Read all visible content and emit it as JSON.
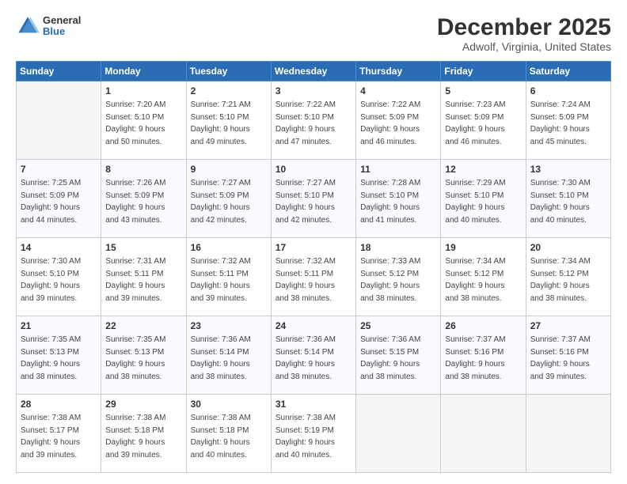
{
  "logo": {
    "general": "General",
    "blue": "Blue"
  },
  "header": {
    "title": "December 2025",
    "subtitle": "Adwolf, Virginia, United States"
  },
  "weekdays": [
    "Sunday",
    "Monday",
    "Tuesday",
    "Wednesday",
    "Thursday",
    "Friday",
    "Saturday"
  ],
  "weeks": [
    [
      {
        "day": "",
        "info": ""
      },
      {
        "day": "1",
        "info": "Sunrise: 7:20 AM\nSunset: 5:10 PM\nDaylight: 9 hours\nand 50 minutes."
      },
      {
        "day": "2",
        "info": "Sunrise: 7:21 AM\nSunset: 5:10 PM\nDaylight: 9 hours\nand 49 minutes."
      },
      {
        "day": "3",
        "info": "Sunrise: 7:22 AM\nSunset: 5:10 PM\nDaylight: 9 hours\nand 47 minutes."
      },
      {
        "day": "4",
        "info": "Sunrise: 7:22 AM\nSunset: 5:09 PM\nDaylight: 9 hours\nand 46 minutes."
      },
      {
        "day": "5",
        "info": "Sunrise: 7:23 AM\nSunset: 5:09 PM\nDaylight: 9 hours\nand 46 minutes."
      },
      {
        "day": "6",
        "info": "Sunrise: 7:24 AM\nSunset: 5:09 PM\nDaylight: 9 hours\nand 45 minutes."
      }
    ],
    [
      {
        "day": "7",
        "info": "Sunrise: 7:25 AM\nSunset: 5:09 PM\nDaylight: 9 hours\nand 44 minutes."
      },
      {
        "day": "8",
        "info": "Sunrise: 7:26 AM\nSunset: 5:09 PM\nDaylight: 9 hours\nand 43 minutes."
      },
      {
        "day": "9",
        "info": "Sunrise: 7:27 AM\nSunset: 5:09 PM\nDaylight: 9 hours\nand 42 minutes."
      },
      {
        "day": "10",
        "info": "Sunrise: 7:27 AM\nSunset: 5:10 PM\nDaylight: 9 hours\nand 42 minutes."
      },
      {
        "day": "11",
        "info": "Sunrise: 7:28 AM\nSunset: 5:10 PM\nDaylight: 9 hours\nand 41 minutes."
      },
      {
        "day": "12",
        "info": "Sunrise: 7:29 AM\nSunset: 5:10 PM\nDaylight: 9 hours\nand 40 minutes."
      },
      {
        "day": "13",
        "info": "Sunrise: 7:30 AM\nSunset: 5:10 PM\nDaylight: 9 hours\nand 40 minutes."
      }
    ],
    [
      {
        "day": "14",
        "info": "Sunrise: 7:30 AM\nSunset: 5:10 PM\nDaylight: 9 hours\nand 39 minutes."
      },
      {
        "day": "15",
        "info": "Sunrise: 7:31 AM\nSunset: 5:11 PM\nDaylight: 9 hours\nand 39 minutes."
      },
      {
        "day": "16",
        "info": "Sunrise: 7:32 AM\nSunset: 5:11 PM\nDaylight: 9 hours\nand 39 minutes."
      },
      {
        "day": "17",
        "info": "Sunrise: 7:32 AM\nSunset: 5:11 PM\nDaylight: 9 hours\nand 38 minutes."
      },
      {
        "day": "18",
        "info": "Sunrise: 7:33 AM\nSunset: 5:12 PM\nDaylight: 9 hours\nand 38 minutes."
      },
      {
        "day": "19",
        "info": "Sunrise: 7:34 AM\nSunset: 5:12 PM\nDaylight: 9 hours\nand 38 minutes."
      },
      {
        "day": "20",
        "info": "Sunrise: 7:34 AM\nSunset: 5:12 PM\nDaylight: 9 hours\nand 38 minutes."
      }
    ],
    [
      {
        "day": "21",
        "info": "Sunrise: 7:35 AM\nSunset: 5:13 PM\nDaylight: 9 hours\nand 38 minutes."
      },
      {
        "day": "22",
        "info": "Sunrise: 7:35 AM\nSunset: 5:13 PM\nDaylight: 9 hours\nand 38 minutes."
      },
      {
        "day": "23",
        "info": "Sunrise: 7:36 AM\nSunset: 5:14 PM\nDaylight: 9 hours\nand 38 minutes."
      },
      {
        "day": "24",
        "info": "Sunrise: 7:36 AM\nSunset: 5:14 PM\nDaylight: 9 hours\nand 38 minutes."
      },
      {
        "day": "25",
        "info": "Sunrise: 7:36 AM\nSunset: 5:15 PM\nDaylight: 9 hours\nand 38 minutes."
      },
      {
        "day": "26",
        "info": "Sunrise: 7:37 AM\nSunset: 5:16 PM\nDaylight: 9 hours\nand 38 minutes."
      },
      {
        "day": "27",
        "info": "Sunrise: 7:37 AM\nSunset: 5:16 PM\nDaylight: 9 hours\nand 39 minutes."
      }
    ],
    [
      {
        "day": "28",
        "info": "Sunrise: 7:38 AM\nSunset: 5:17 PM\nDaylight: 9 hours\nand 39 minutes."
      },
      {
        "day": "29",
        "info": "Sunrise: 7:38 AM\nSunset: 5:18 PM\nDaylight: 9 hours\nand 39 minutes."
      },
      {
        "day": "30",
        "info": "Sunrise: 7:38 AM\nSunset: 5:18 PM\nDaylight: 9 hours\nand 40 minutes."
      },
      {
        "day": "31",
        "info": "Sunrise: 7:38 AM\nSunset: 5:19 PM\nDaylight: 9 hours\nand 40 minutes."
      },
      {
        "day": "",
        "info": ""
      },
      {
        "day": "",
        "info": ""
      },
      {
        "day": "",
        "info": ""
      }
    ]
  ]
}
